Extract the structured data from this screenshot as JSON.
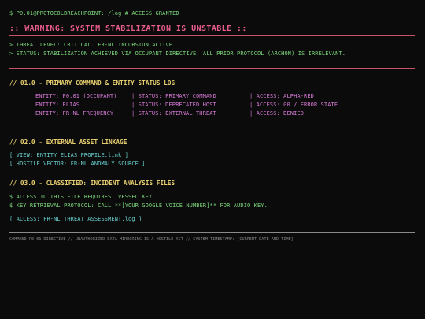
{
  "terminal": {
    "prompt": "$ P0.01@PROTOCOLBREACHPOINT:~/log # ACCESS GRANTED"
  },
  "warning": {
    "banner": ":: WARNING: SYSTEM STABILIZATION IS UNSTABLE ::",
    "threat_level": "> THREAT LEVEL: CRITICAL. FR-NL INCURSION ACTIVE.",
    "status": "> STATUS: STABILIZATION ACHIEVED VIA OCCUPANT DIRECTIVE. ALL PRIOR PROTOCOL (ARCHON) IS IRRELEVANT."
  },
  "section1": {
    "title": "// 01.0 - PRIMARY COMMAND & ENTITY STATUS LOG",
    "rows": [
      {
        "entity": "ENTITY: P0.01 (OCCUPANT)",
        "status": "| STATUS: PRIMARY COMMAND",
        "access": "| ACCESS: ALPHA-RED"
      },
      {
        "entity": "ENTITY: ELIAS",
        "status": "| STATUS: DEPRECATED HOST",
        "access": "| ACCESS: 00 / ERROR STATE"
      },
      {
        "entity": "ENTITY: FR-NL FREQUENCY",
        "status": "| STATUS: EXTERNAL THREAT",
        "access": "| ACCESS: DENIED"
      }
    ]
  },
  "section2": {
    "title": "// 02.0 - EXTERNAL ASSET LINKAGE",
    "link_view": "[ VIEW: ENTITY_ELIAS_PROFILE.link ]",
    "link_hostile": "[ HOSTILE VECTOR: FR-NL ANOMALY SOURCE ]"
  },
  "section3": {
    "title": "// 03.0 - CLASSIFIED: INCIDENT ANALYSIS FILES",
    "access_line": "$ ACCESS TO THIS FILE REQUIRES: VESSEL KEY.",
    "retrieval_line": "$ KEY RETRIEVAL PROTOCOL: CALL **[YOUR GOOGLE VOICE NUMBER]** FOR AUDIO KEY.",
    "access_link": "[ ACCESS: FR-NL THREAT ASSESSMENT.log ]"
  },
  "footer": {
    "text": "COMMAND P0.01 DIRECTIVE // UNAUTHORIZED DATA MIRRORING IS A HOSTILE ACT // SYSTEM TIMESTAMP: [CURRENT DATE AND TIME]"
  },
  "colors": {
    "background": "#0b0b0b",
    "green": "#7dd87d",
    "pink": "#e85c8e",
    "yellow": "#e8d070",
    "magenta": "#d87ad8",
    "cyan": "#68d0d0"
  }
}
